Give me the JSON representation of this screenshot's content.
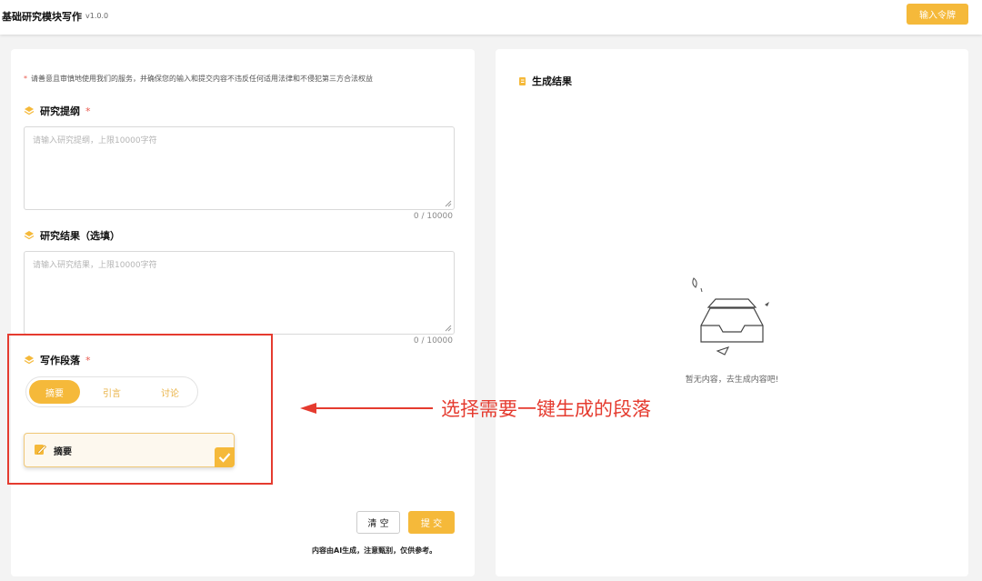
{
  "header": {
    "title": "基础研究模块写作",
    "version": "v1.0.0",
    "token_button": "输入令牌"
  },
  "form": {
    "notice_star": "*",
    "notice": "请善意且审慎地使用我们的服务，并确保您的输入和提交内容不违反任何适用法律和不侵犯第三方合法权益",
    "outline": {
      "label": "研究提纲",
      "required": "*",
      "placeholder": "请输入研究提纲，上限10000字符",
      "counter": "0 / 10000"
    },
    "results": {
      "label": "研究结果（选填）",
      "placeholder": "请输入研究结果，上限10000字符",
      "counter": "0 / 10000"
    },
    "paragraph": {
      "label": "写作段落",
      "required": "*",
      "tabs": [
        "摘要",
        "引言",
        "讨论"
      ],
      "selected_tab": "摘要",
      "card_label": "摘要"
    },
    "clear_button": "清 空",
    "submit_button": "提 交",
    "disclaimer": "内容由AI生成，注意甄别，仅供参考。"
  },
  "result": {
    "title": "生成结果",
    "empty_text": "暂无内容，去生成内容吧!"
  },
  "annotation": {
    "text": "选择需要一键生成的段落"
  },
  "colors": {
    "accent": "#f5b93a",
    "annotation": "#e53b2f",
    "required": "#e85a4f"
  }
}
